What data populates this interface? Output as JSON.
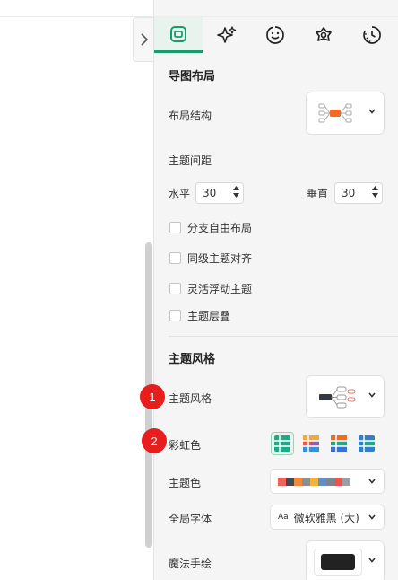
{
  "tabs": [
    {
      "name": "layout",
      "icon": "layout-icon",
      "active": true
    },
    {
      "name": "ai",
      "icon": "sparkle-icon",
      "active": false
    },
    {
      "name": "sticker",
      "icon": "smiley-icon",
      "active": false
    },
    {
      "name": "theme",
      "icon": "flower-icon",
      "active": false
    },
    {
      "name": "history",
      "icon": "clock-icon",
      "active": false
    }
  ],
  "map_layout": {
    "title": "导图布局",
    "structure_label": "布局结构",
    "spacing_label": "主题间距",
    "horizontal_label": "水平",
    "horizontal_value": "30",
    "vertical_label": "垂直",
    "vertical_value": "30",
    "options": [
      {
        "label": "分支自由布局",
        "checked": false
      },
      {
        "label": "同级主题对齐",
        "checked": false
      },
      {
        "label": "灵活浮动主题",
        "checked": false
      },
      {
        "label": "主题层叠",
        "checked": false
      }
    ]
  },
  "topic_style": {
    "title": "主题风格",
    "style_label": "主题风格",
    "rainbow_label": "彩虹色",
    "color_label": "主题色",
    "font_label": "全局字体",
    "font_glyph": "Aa",
    "font_value": "微软雅黑 (大)",
    "handdrawn_label": "魔法手绘",
    "swatches": [
      "#f0625a",
      "#444a55",
      "#f28a3b",
      "#8a8f96",
      "#f2b43b",
      "#5e8fc7",
      "#7a8592",
      "#e8554e",
      "#9a9fa6"
    ]
  },
  "badges": [
    "1",
    "2"
  ],
  "colors": {
    "accent": "#1a9b6c",
    "badge": "#e61e1e",
    "node_orange": "#f26b22"
  }
}
